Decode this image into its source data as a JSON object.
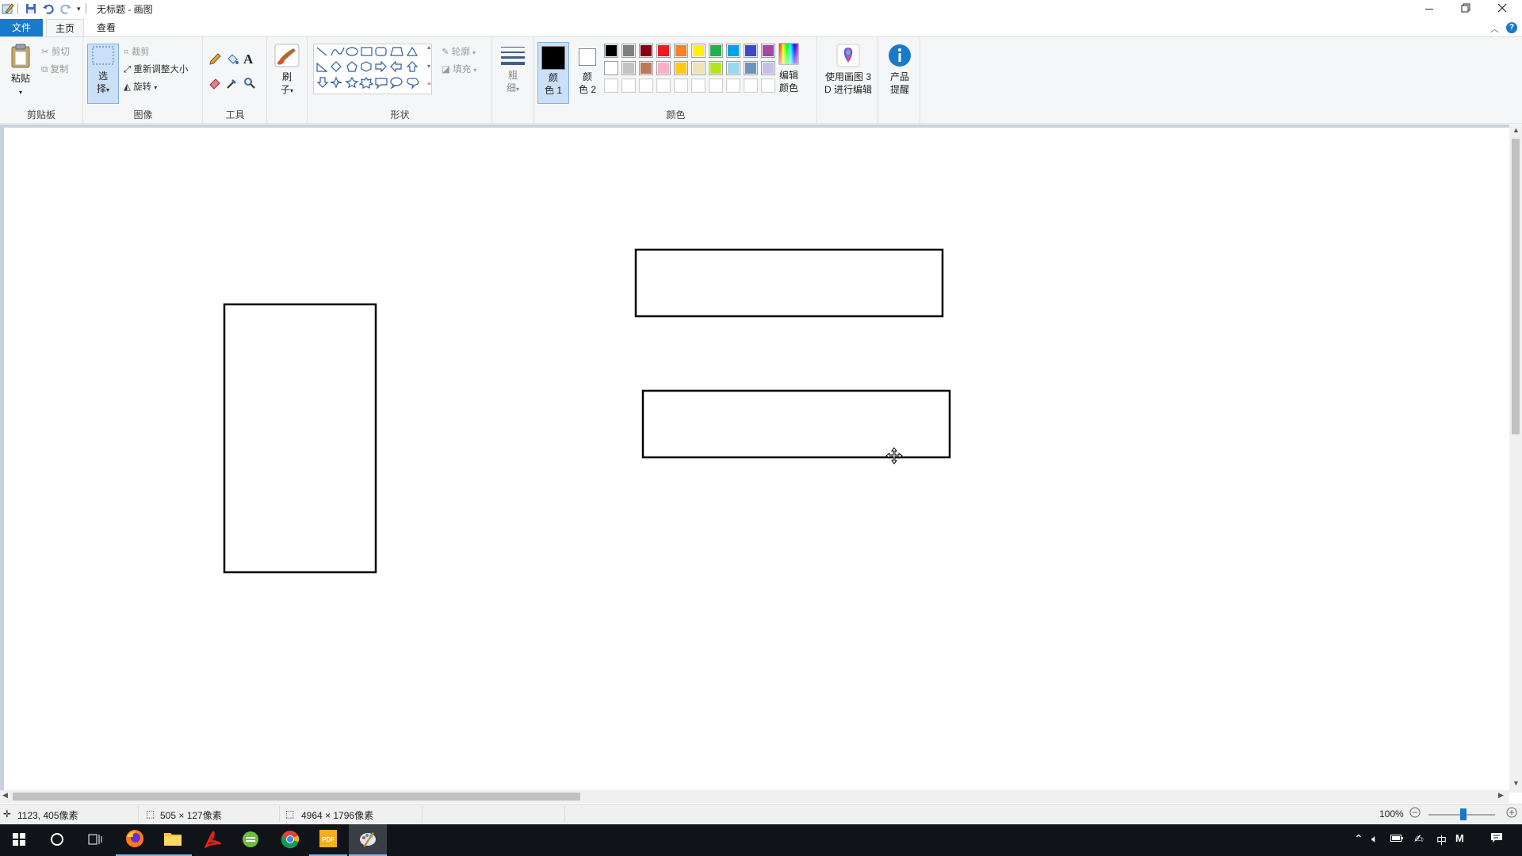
{
  "window": {
    "title": "无标题 - 画图",
    "minimize": "—",
    "restore": "❐",
    "close": "✕"
  },
  "tabs": {
    "file": "文件",
    "home": "主页",
    "view": "查看"
  },
  "clipboard": {
    "paste": "粘贴",
    "cut": "剪切",
    "copy": "复制",
    "label": "剪贴板"
  },
  "image": {
    "select_line1": "选",
    "select_line2": "择",
    "crop": "裁剪",
    "resize": "重新调整大小",
    "rotate": "旋转",
    "label": "图像"
  },
  "tools": {
    "label": "工具",
    "text_glyph": "A"
  },
  "brushes": {
    "line1": "刷",
    "line2": "子"
  },
  "shapes": {
    "outline": "轮廓",
    "fill": "填充",
    "label": "形状"
  },
  "size": {
    "line1": "粗",
    "line2": "细"
  },
  "colors": {
    "color1_line1": "颜",
    "color1_line2": "色 1",
    "color2_line1": "颜",
    "color2_line2": "色 2",
    "edit_line1": "编辑",
    "edit_line2": "颜色",
    "label": "颜色",
    "palette_row1": [
      "#000000",
      "#7f7f7f",
      "#880015",
      "#ed1c24",
      "#ff7f27",
      "#fff200",
      "#22b14c",
      "#00a2e8",
      "#3f48cc",
      "#a349a4"
    ],
    "palette_row2": [
      "#ffffff",
      "#c3c3c3",
      "#b97a57",
      "#ffaec9",
      "#ffc90e",
      "#efe4b0",
      "#b5e61d",
      "#99d9ea",
      "#7092be",
      "#c8bfe7"
    ],
    "palette_row3": [
      "#ffffff",
      "#ffffff",
      "#ffffff",
      "#ffffff",
      "#ffffff",
      "#ffffff",
      "#ffffff",
      "#ffffff",
      "#ffffff",
      "#ffffff"
    ],
    "color1": "#000000",
    "color2": "#ffffff"
  },
  "paint3d": {
    "line1": "使用画图 3",
    "line2": "D 进行编辑"
  },
  "product_alert": {
    "line1": "产品",
    "line2": "提醒"
  },
  "status": {
    "cursor_pos": "1123, 405像素",
    "selection_size": "505 × 127像素",
    "image_size": "4964 × 1796像素",
    "zoom": "100%"
  },
  "accent": "#1979ca"
}
